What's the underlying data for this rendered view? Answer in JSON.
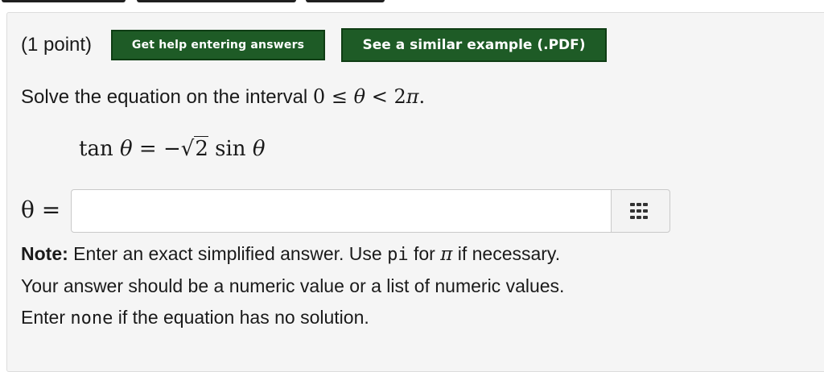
{
  "points_label": "(1 point)",
  "buttons": {
    "help_label": "Get help entering answers",
    "example_label": "See a similar example (.PDF)"
  },
  "question": {
    "prefix": "Solve the equation on the interval ",
    "interval_lower": "0",
    "le": "≤",
    "theta": "θ",
    "lt": "<",
    "upper": "2",
    "pi": "π",
    "period": "."
  },
  "equation": {
    "tan": "tan",
    "theta": "θ",
    "equals": "=",
    "minus": "−",
    "radicand": "2",
    "sin": "sin"
  },
  "answer": {
    "label": "θ =",
    "value": "",
    "placeholder": ""
  },
  "keypad_icon": "keypad-grid-icon",
  "note": {
    "bold": "Note:",
    "line1_text": " Enter an exact simplified answer. Use ",
    "line1_code": "pi",
    "line1_for": " for ",
    "line1_pi": "π",
    "line1_end": " if necessary.",
    "line2": "Your answer should be a numeric value or a list of numeric values.",
    "line3_start": "Enter ",
    "line3_code": "none",
    "line3_end": " if the equation has no solution."
  },
  "colors": {
    "button_green": "#1e5b26",
    "panel_bg": "#f5f5f5"
  }
}
